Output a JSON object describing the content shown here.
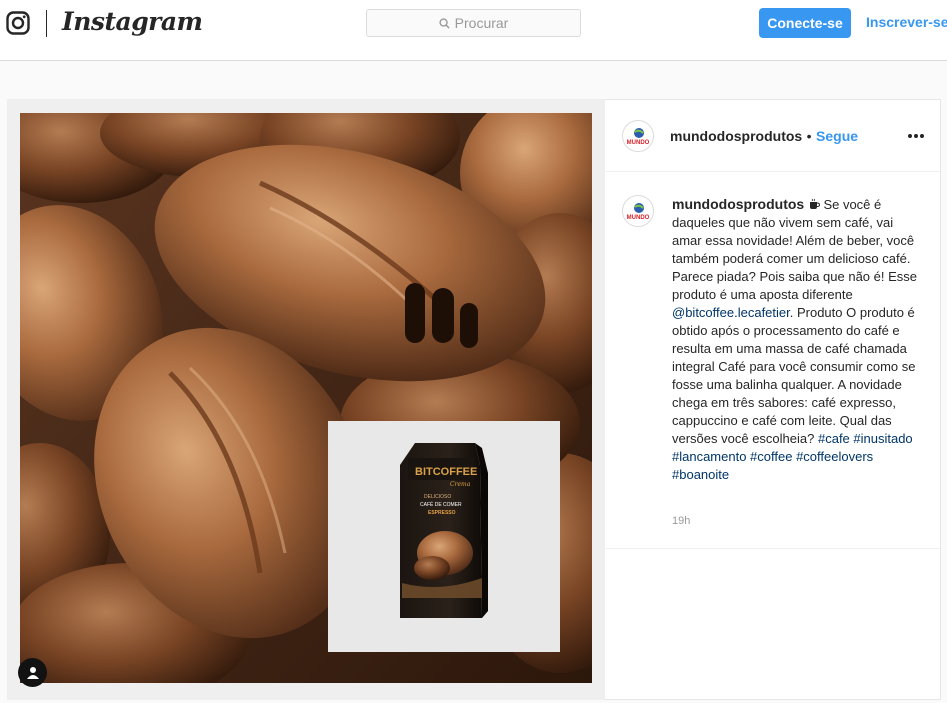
{
  "header": {
    "wordmark": "Instagram",
    "search_placeholder": "Procurar",
    "login_button": "Conecte-se",
    "signup_link": "Inscrever-se"
  },
  "post": {
    "author": "mundodosprodutos",
    "separator": "•",
    "follow_label": "Segue",
    "avatar_text": "MUNDO",
    "product_brand": "BITCOFFEE",
    "product_line": "Crema",
    "product_label_1": "DELICIOSO",
    "product_label_2": "CAFÉ DE COMER",
    "product_flavor": "ESPRESSO",
    "caption": {
      "author": "mundodosprodutos",
      "icon": "coffee-cup-icon",
      "text_before_mention": " Se você é daqueles que não vivem sem café, vai amar essa novidade! Além de beber, você também poderá comer um delicioso café. Parece piada? Pois saiba que não é! Esse produto é uma aposta diferente ",
      "mention": "@bitcoffee.lecafetier",
      "text_after_mention": ". Produto O produto é obtido após o processamento do café e resulta em uma massa de café chamada integral Café para você consumir como se fosse uma balinha qualquer. A novidade chega em três sabores: café expresso, cappuccino e café com leite. Qual das versões você escolheia?",
      "hashtags": "#cafe #inusitado #lancamento #coffee #coffeelovers #boanoite"
    },
    "timestamp": "19h"
  }
}
